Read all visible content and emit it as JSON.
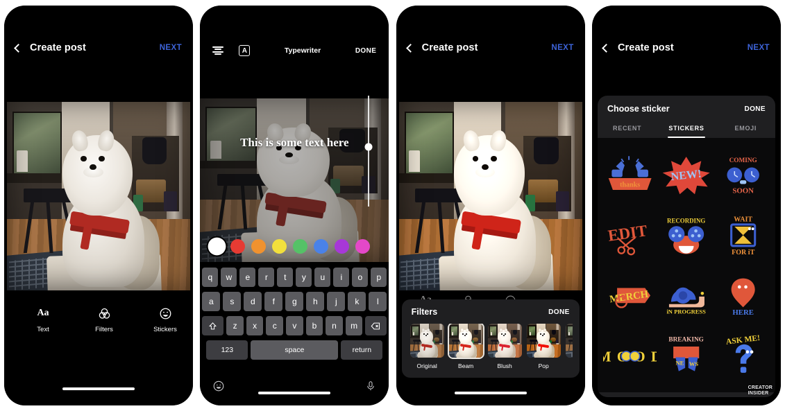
{
  "app": {
    "background_color": "#ffffff",
    "phone_body_color": "#000000"
  },
  "phone1": {
    "header": {
      "back_icon": "chevron-left-icon",
      "title": "Create post",
      "next_label": "NEXT",
      "next_color": "#3d63d8"
    },
    "photo_alt": "white fluffy dog with red harness sitting indoors",
    "toolbar": [
      {
        "icon": "text-aa-icon",
        "glyph": "Aa",
        "label": "Text"
      },
      {
        "icon": "filters-circles-icon",
        "glyph": "",
        "label": "Filters"
      },
      {
        "icon": "sticker-smiley-icon",
        "glyph": "",
        "label": "Stickers"
      }
    ],
    "home_indicator": true
  },
  "phone2": {
    "editor_header": {
      "align_icon": "text-align-icon",
      "style_icon": "letter-a-box-icon",
      "font_label": "Typewriter",
      "done_label": "DONE"
    },
    "overlay_text": "This is some text here",
    "slider": {
      "name": "text-size-slider",
      "value_pct": 46
    },
    "colors": [
      {
        "name": "white",
        "hex": "#ffffff",
        "selected": true
      },
      {
        "name": "red",
        "hex": "#e63b33",
        "selected": false
      },
      {
        "name": "orange",
        "hex": "#f0922f",
        "selected": false
      },
      {
        "name": "yellow",
        "hex": "#f2e03c",
        "selected": false
      },
      {
        "name": "green",
        "hex": "#55c267",
        "selected": false
      },
      {
        "name": "blue",
        "hex": "#4a82e8",
        "selected": false
      },
      {
        "name": "purple",
        "hex": "#a738d8",
        "selected": false
      },
      {
        "name": "magenta",
        "hex": "#e448c8",
        "selected": false
      }
    ],
    "keyboard": {
      "row1": [
        "q",
        "w",
        "e",
        "r",
        "t",
        "y",
        "u",
        "i",
        "o",
        "p"
      ],
      "row2": [
        "a",
        "s",
        "d",
        "f",
        "g",
        "h",
        "j",
        "k",
        "l"
      ],
      "row3": [
        "z",
        "x",
        "c",
        "v",
        "b",
        "n",
        "m"
      ],
      "shift_icon": "shift-icon",
      "backspace_icon": "backspace-icon",
      "numbers_label": "123",
      "space_label": "space",
      "return_label": "return",
      "emoji_icon": "emoji-smiley-icon",
      "mic_icon": "microphone-icon"
    }
  },
  "phone3": {
    "header": {
      "back_icon": "chevron-left-icon",
      "title": "Create post",
      "next_label": "NEXT"
    },
    "filters_panel": {
      "title": "Filters",
      "done_label": "DONE",
      "items": [
        {
          "label": "Original",
          "selected": false
        },
        {
          "label": "Beam",
          "selected": true
        },
        {
          "label": "Blush",
          "selected": false
        },
        {
          "label": "Pop",
          "selected": false
        },
        {
          "label": "",
          "selected": false
        }
      ]
    }
  },
  "phone4": {
    "header": {
      "back_icon": "chevron-left-icon",
      "title": "Create post",
      "next_label": "NEXT"
    },
    "sticker_panel": {
      "title": "Choose sticker",
      "done_label": "DONE",
      "tabs": [
        {
          "label": "RECENT",
          "active": false
        },
        {
          "label": "STICKERS",
          "active": true
        },
        {
          "label": "EMOJI",
          "active": false
        }
      ],
      "stickers": [
        {
          "name": "thanks-thumbs-up-sticker",
          "text": "thanks",
          "text_color": "#f0923a",
          "shape": "thumbs",
          "shape_color": "#4a6fd6"
        },
        {
          "name": "new-burst-sticker",
          "text": "NEW!",
          "text_color": "#9fc4f5",
          "shape": "burst",
          "shape_color": "#e0483a"
        },
        {
          "name": "coming-soon-clock-sticker",
          "text": "COMING SOON",
          "text_color": "#e8654a",
          "shape": "clocks",
          "shape_color": "#3c5fd0"
        },
        {
          "name": "edit-scissors-sticker",
          "text": "EDIT",
          "text_color": "#4a79e8",
          "shape": "scissors",
          "shape_color": "#e0573a"
        },
        {
          "name": "recording-reels-sticker",
          "text": "RECORDING",
          "text_color": "#f0d03a",
          "shape": "reels",
          "shape_color": "#3c5fd0"
        },
        {
          "name": "wait-for-it-hourglass-sticker",
          "text": "WAIT FOR IT",
          "text_color": "#f0923a",
          "shape": "hourglass",
          "shape_color": "#3c5fd0"
        },
        {
          "name": "merch-tag-sticker",
          "text": "MERCH",
          "text_color": "#f0d03a",
          "shape": "tag",
          "shape_color": "#e0573a"
        },
        {
          "name": "in-progress-snail-sticker",
          "text": "iN PROGRESS",
          "text_color": "#f0d03a",
          "shape": "snail",
          "shape_color": "#3c5fd0"
        },
        {
          "name": "here-pin-sticker",
          "text": "HERE",
          "text_color": "#4a79e8",
          "shape": "pin",
          "shape_color": "#e0573a"
        },
        {
          "name": "mood-faces-sticker",
          "text": "MOOD",
          "text_color": "#f0d03a",
          "shape": "faces",
          "shape_color": "#3c5fd0"
        },
        {
          "name": "breaking-news-sticker",
          "text": "BREAKING",
          "text_color": "#f0b8a8",
          "shape": "news",
          "shape_color": "#3c5fd0"
        },
        {
          "name": "ask-me-question-sticker",
          "text": "ASK ME!",
          "text_color": "#f0d03a",
          "shape": "question",
          "shape_color": "#4a79e8"
        }
      ]
    }
  },
  "watermark": {
    "line1": "CREATOR",
    "line2": "INSIDER"
  }
}
